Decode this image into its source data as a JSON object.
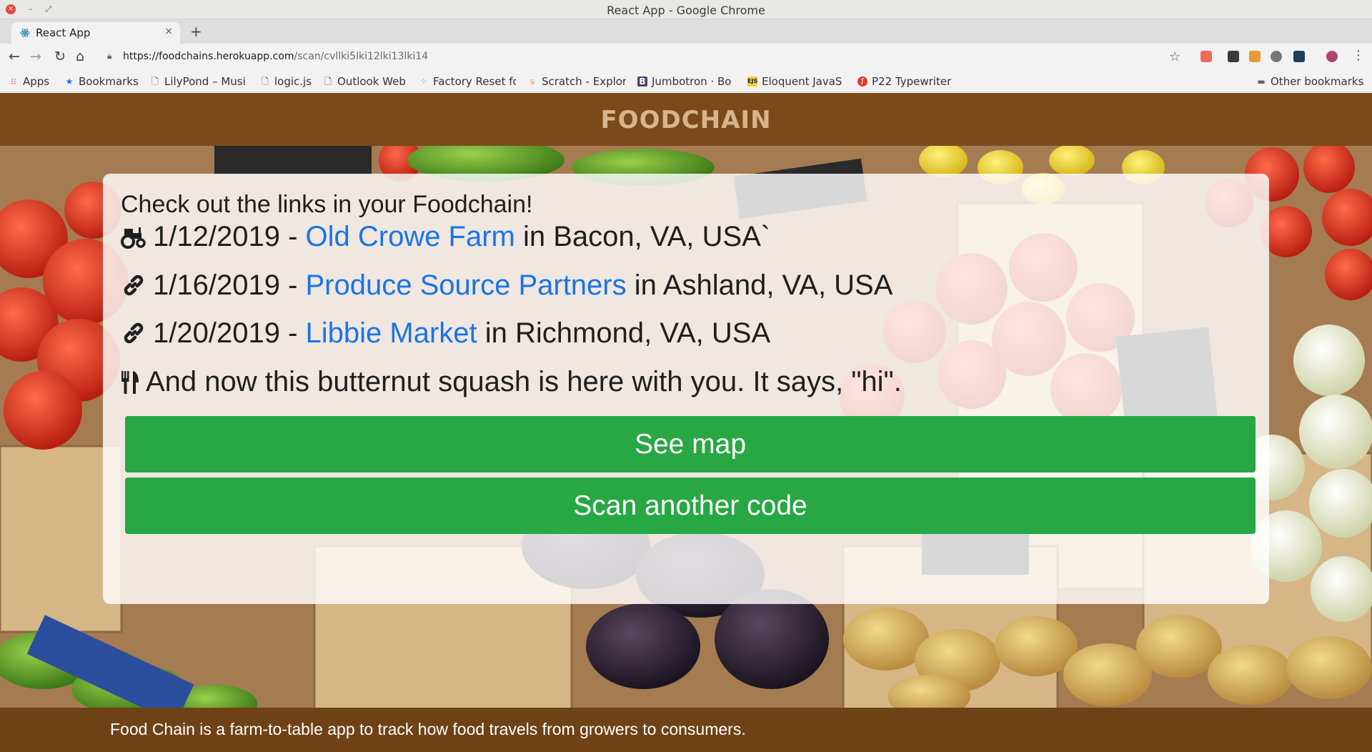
{
  "window": {
    "title": "React App - Google Chrome"
  },
  "tab": {
    "title": "React App",
    "close": "×",
    "new_tab": "+"
  },
  "toolbar": {
    "back": "←",
    "forward": "→",
    "reload": "↻",
    "home": "⌂",
    "url_host": "https://foodchains.herokuapp.com",
    "url_path": "/scan/cvllki5lki12lki13lki14",
    "star": "☆",
    "menu": "⋮"
  },
  "bookmarks": {
    "items": [
      {
        "label": "Apps",
        "icon": "apps-grid-icon"
      },
      {
        "label": "Bookmarks",
        "icon": "star-icon"
      },
      {
        "label": "LilyPond – Musi",
        "icon": "page-icon"
      },
      {
        "label": "logic.js",
        "icon": "page-icon"
      },
      {
        "label": "Outlook Web",
        "icon": "page-icon"
      },
      {
        "label": "Factory Reset fo",
        "icon": "dots-icon"
      },
      {
        "label": "Scratch - Explor",
        "icon": "scratch-icon"
      },
      {
        "label": "Jumbotron · Bo",
        "icon": "bootstrap-icon"
      },
      {
        "label": "Eloquent JavaS",
        "icon": "ejs-icon"
      },
      {
        "label": "P22 Typewriter",
        "icon": "typewriter-icon"
      }
    ],
    "other": "Other bookmarks"
  },
  "header": {
    "logo": "FOODCHAIN"
  },
  "card": {
    "heading": "Check out the links in your Foodchain!",
    "links": [
      {
        "icon": "tractor-icon",
        "date": "1/12/2019",
        "separator": " - ",
        "name": "Old Crowe Farm",
        "location": " in Bacon, VA, USA`"
      },
      {
        "icon": "link-icon",
        "date": "1/16/2019",
        "separator": " - ",
        "name": "Produce Source Partners",
        "location": " in Ashland, VA, USA"
      },
      {
        "icon": "link-icon",
        "date": "1/20/2019",
        "separator": " - ",
        "name": "Libbie Market",
        "location": " in Richmond, VA, USA"
      }
    ],
    "final": {
      "icon": "utensils-icon",
      "text": "And now this butternut squash is here with you. It says, \"hi\"."
    },
    "see_map": "See map",
    "scan_another": "Scan another code"
  },
  "footer": {
    "text": "Food Chain is a farm-to-table app to track how food travels from growers to consumers."
  },
  "colors": {
    "header_brown": "#7b4a1b",
    "footer_brown": "#6e4216",
    "logo": "#d7b48c",
    "link_blue": "#1a74e6",
    "button_green": "#28a745"
  }
}
